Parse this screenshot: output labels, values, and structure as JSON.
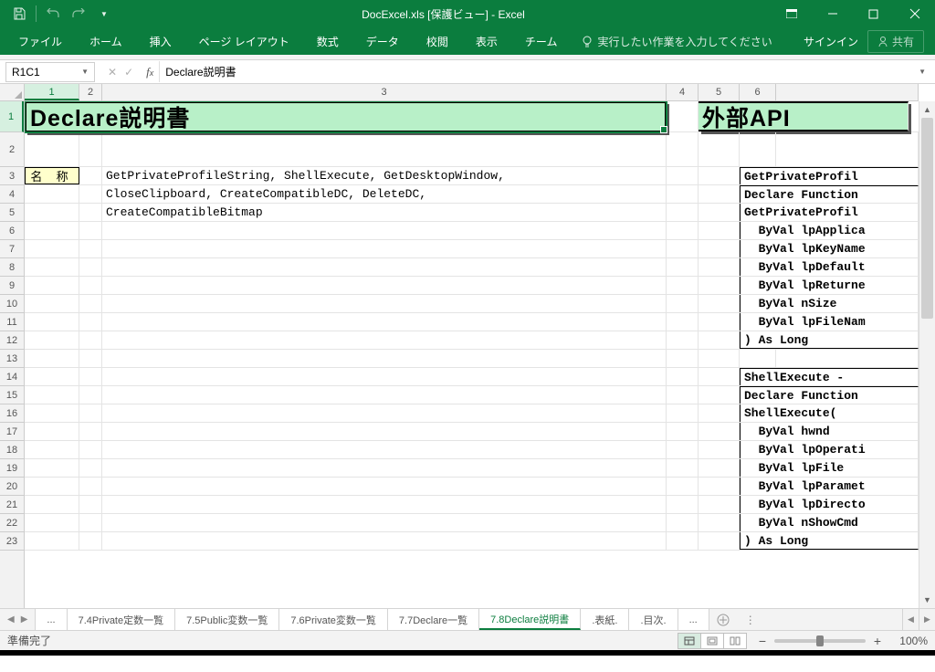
{
  "titlebar": {
    "title": "DocExcel.xls  [保護ビュー] - Excel"
  },
  "ribbon": {
    "tabs": [
      "ファイル",
      "ホーム",
      "挿入",
      "ページ レイアウト",
      "数式",
      "データ",
      "校閲",
      "表示",
      "チーム"
    ],
    "tell_me": "実行したい作業を入力してください",
    "signin": "サインイン",
    "share": "共有"
  },
  "formula_bar": {
    "name_box": "R1C1",
    "formula": "Declare説明書"
  },
  "columns": [
    "1",
    "2",
    "3",
    "4",
    "5",
    "6",
    ""
  ],
  "rows": [
    "1",
    "2",
    "3",
    "4",
    "5",
    "6",
    "7",
    "8",
    "9",
    "10",
    "11",
    "12",
    "13",
    "14",
    "15",
    "16",
    "17",
    "18",
    "19",
    "20",
    "21",
    "22",
    "23"
  ],
  "cells": {
    "title_left": "Declare説明書",
    "title_right": "外部API",
    "label_name": "名 称",
    "r3c3": "GetPrivateProfileString, ShellExecute, GetDesktopWindow,",
    "r4c3": "CloseClipboard, CreateCompatibleDC, DeleteDC,",
    "r5c3": "CreateCompatibleBitmap",
    "ext": {
      "3": "GetPrivateProfil",
      "4": "Declare Function",
      "5": "GetPrivateProfil",
      "6": "  ByVal lpApplica",
      "7": "  ByVal lpKeyName",
      "8": "  ByVal lpDefault",
      "9": "  ByVal lpReturne",
      "10": "  ByVal nSize",
      "11": "  ByVal lpFileNam",
      "12": ") As Long",
      "14": "ShellExecute - ",
      "15": "Declare Function",
      "16": "ShellExecute(",
      "17": "  ByVal hwnd",
      "18": "  ByVal lpOperati",
      "19": "  ByVal lpFile",
      "20": "  ByVal lpParamet",
      "21": "  ByVal lpDirecto",
      "22": "  ByVal nShowCmd",
      "23": ") As Long"
    }
  },
  "sheet_tabs": {
    "prefix": "...",
    "tabs": [
      "7.4Private定数一覧",
      "7.5Public変数一覧",
      "7.6Private変数一覧",
      "7.7Declare一覧",
      "7.8Declare説明書",
      ".表紙.",
      ".目次."
    ],
    "active_index": 4,
    "suffix": "..."
  },
  "statusbar": {
    "ready": "準備完了",
    "zoom": "100%"
  }
}
